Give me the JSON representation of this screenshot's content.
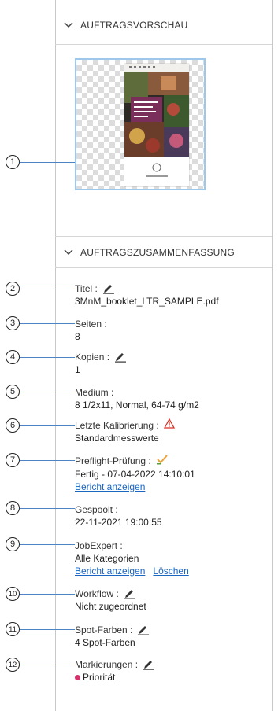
{
  "preview": {
    "header": "AUFTRAGSVORSCHAU"
  },
  "summary": {
    "header": "AUFTRAGSZUSAMMENFASSUNG",
    "title": {
      "label": "Titel :",
      "value": "3MnM_booklet_LTR_SAMPLE.pdf"
    },
    "pages": {
      "label": "Seiten :",
      "value": "8"
    },
    "copies": {
      "label": "Kopien :",
      "value": "1"
    },
    "media": {
      "label": "Medium :",
      "value": "8 1/2x11, Normal, 64-74 g/m2"
    },
    "calibration": {
      "label": "Letzte Kalibrierung :",
      "value": "Standardmesswerte"
    },
    "preflight": {
      "label": "Preflight-Prüfung :",
      "value": "Fertig - 07-04-2022 14:10:01",
      "link": "Bericht anzeigen"
    },
    "spooled": {
      "label": "Gespoolt :",
      "value": "22-11-2021 19:00:55"
    },
    "jobexpert": {
      "label": "JobExpert :",
      "value": "Alle Kategorien",
      "link": "Bericht anzeigen",
      "link2": "Löschen"
    },
    "workflow": {
      "label": "Workflow :",
      "value": "Nicht zugeordnet"
    },
    "spot": {
      "label": "Spot-Farben :",
      "value": "4 Spot-Farben"
    },
    "markings": {
      "label": "Markierungen :",
      "value": "Priorität",
      "dot_color": "#d6336c"
    }
  },
  "callouts": [
    "1",
    "2",
    "3",
    "4",
    "5",
    "6",
    "7",
    "8",
    "9",
    "10",
    "11",
    "12"
  ],
  "colors": {
    "link": "#1a66c2",
    "leader": "#4a84c4",
    "thumb_border": "#9ec7ec",
    "warning": "#d93025",
    "check": "#e8a23a"
  }
}
